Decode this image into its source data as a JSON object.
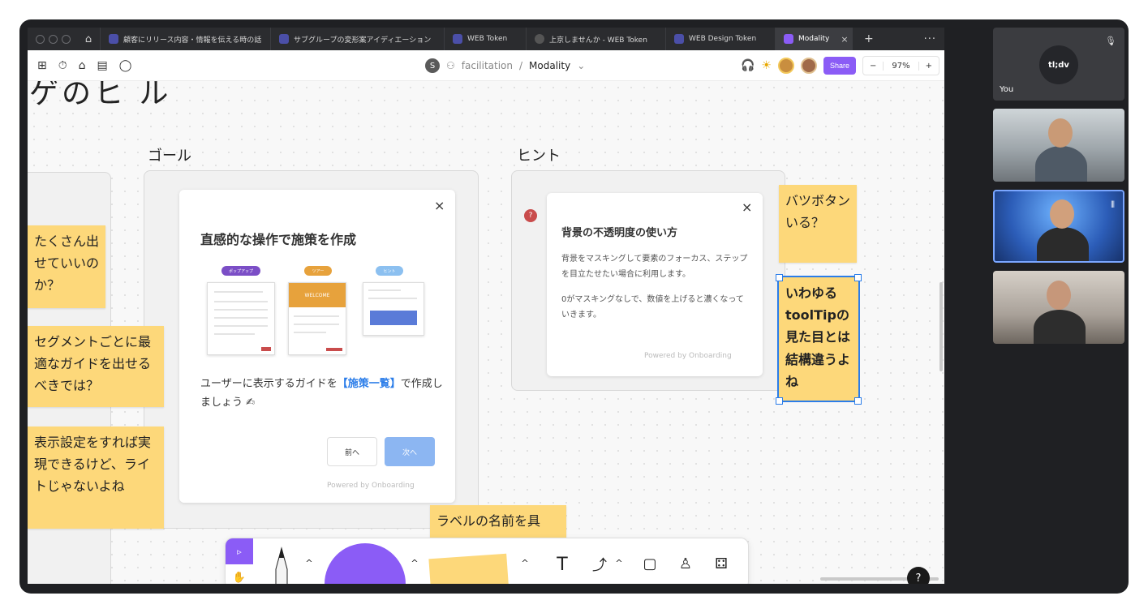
{
  "browser": {
    "tabs": [
      {
        "label": "顧客にリリース内容・情報を伝える時の話",
        "active": false
      },
      {
        "label": "サブグループの変形案アイディエーション",
        "active": false
      },
      {
        "label": "WEB Token",
        "active": false
      },
      {
        "label": "上京しませんか - WEB Token",
        "active": false
      },
      {
        "label": "WEB Design Token",
        "active": false
      },
      {
        "label": "Modality",
        "active": true
      }
    ],
    "close_icon": "×",
    "new_tab": "+",
    "more": "···"
  },
  "toolbar": {
    "user_initial": "S",
    "project": "facilitation",
    "separator": "/",
    "document": "Modality",
    "share_label": "Share",
    "zoom_minus": "−",
    "zoom_level": "97%",
    "zoom_plus": "+"
  },
  "canvas": {
    "big_title": "ゲのヒ ル",
    "goal_label": "ゴール",
    "hint_label": "ヒント",
    "goal_card": {
      "title": "直感的な操作で施策を作成",
      "close": "×",
      "pills": [
        "ポップアップ",
        "ツアー",
        "ヒント"
      ],
      "welcome": "WELCOME",
      "text_before": "ユーザーに表示するガイドを",
      "text_link": "【施策一覧】",
      "text_after": "で作成しましょう ✍",
      "prev_label": "前へ",
      "next_label": "次へ",
      "powered": "Powered by Onboarding"
    },
    "hint_card": {
      "badge": "?",
      "title": "背景の不透明度の使い方",
      "close": "×",
      "para1": "背景をマスキングして要素のフォーカス、ステップを目立たせたい場合に利用します。",
      "para2": "0がマスキングなしで、数値を上げると濃くなっていきます。",
      "powered": "Powered by Onboarding"
    },
    "stickies": [
      "たくさん出せていいのか？",
      "セグメントごとに最適なガイドを出せるべきでは？",
      "表示設定をすれば実現できるけど、ライトじゃないよね",
      "バツボタンいる？",
      "いわゆるtoolTipの見た目とは結構違うよね",
      "ラベルの名前を具"
    ],
    "help": "?"
  },
  "bottom_tools": {
    "text_tool": "T",
    "chevron": "^"
  },
  "meeting": {
    "you_label": "You",
    "you_logo": "tl;dv"
  },
  "colors": {
    "accent": "#8b5cf6",
    "sticky": "#fdd87a",
    "selection": "#2b7de9"
  }
}
